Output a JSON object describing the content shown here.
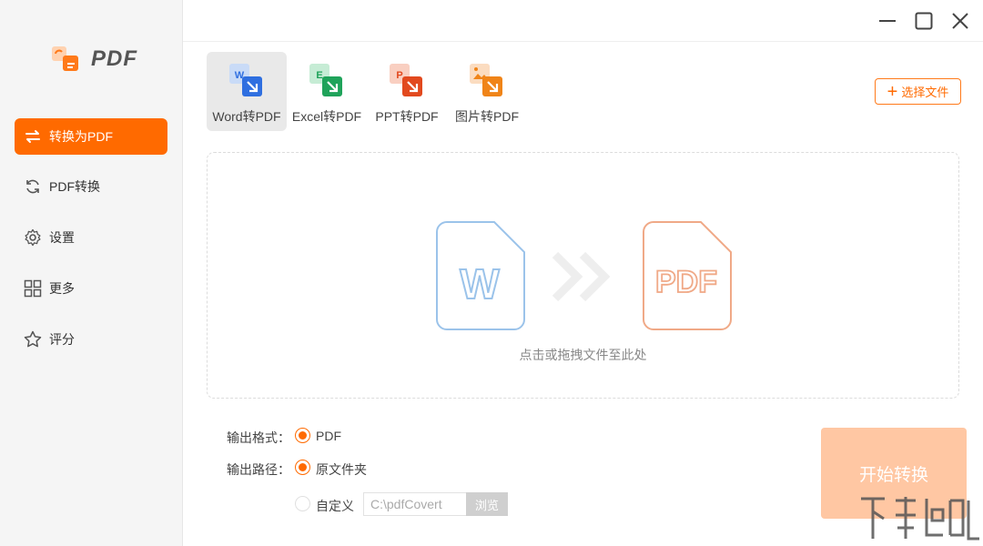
{
  "app": {
    "logo_text": "PDF"
  },
  "sidebar": {
    "items": [
      {
        "label": "转换为PDF",
        "icon": "convert-arrows-icon",
        "active": true
      },
      {
        "label": "PDF转换",
        "icon": "refresh-icon",
        "active": false
      },
      {
        "label": "设置",
        "icon": "gear-icon",
        "active": false
      },
      {
        "label": "更多",
        "icon": "grid-icon",
        "active": false
      },
      {
        "label": "评分",
        "icon": "star-icon",
        "active": false
      }
    ]
  },
  "window": {
    "controls": [
      "minimize",
      "maximize",
      "close"
    ]
  },
  "tabs": [
    {
      "label": "Word转PDF",
      "badge": "W",
      "color": "#2f6fe0",
      "active": true
    },
    {
      "label": "Excel转PDF",
      "badge": "E",
      "color": "#1fa35a",
      "active": false
    },
    {
      "label": "PPT转PDF",
      "badge": "P",
      "color": "#e2491e",
      "active": false
    },
    {
      "label": "图片转PDF",
      "badge": "",
      "color": "#f08418",
      "active": false
    }
  ],
  "select_file": {
    "label": "选择文件"
  },
  "dropzone": {
    "source_letter": "W",
    "target_text": "PDF",
    "hint": "点击或拖拽文件至此处"
  },
  "options": {
    "format_label": "输出格式：",
    "format_value": "PDF",
    "path_label": "输出路径：",
    "path_original": "原文件夹",
    "path_custom": "自定义",
    "path_value": "C:\\pdfCovert",
    "browse_label": "浏览"
  },
  "start_button": {
    "label": "开始转换"
  },
  "colors": {
    "accent": "#ff6a00",
    "start_disabled": "#ffc7a3",
    "word_blue": "#9bc3ea",
    "pdf_orange": "#f0a987"
  }
}
